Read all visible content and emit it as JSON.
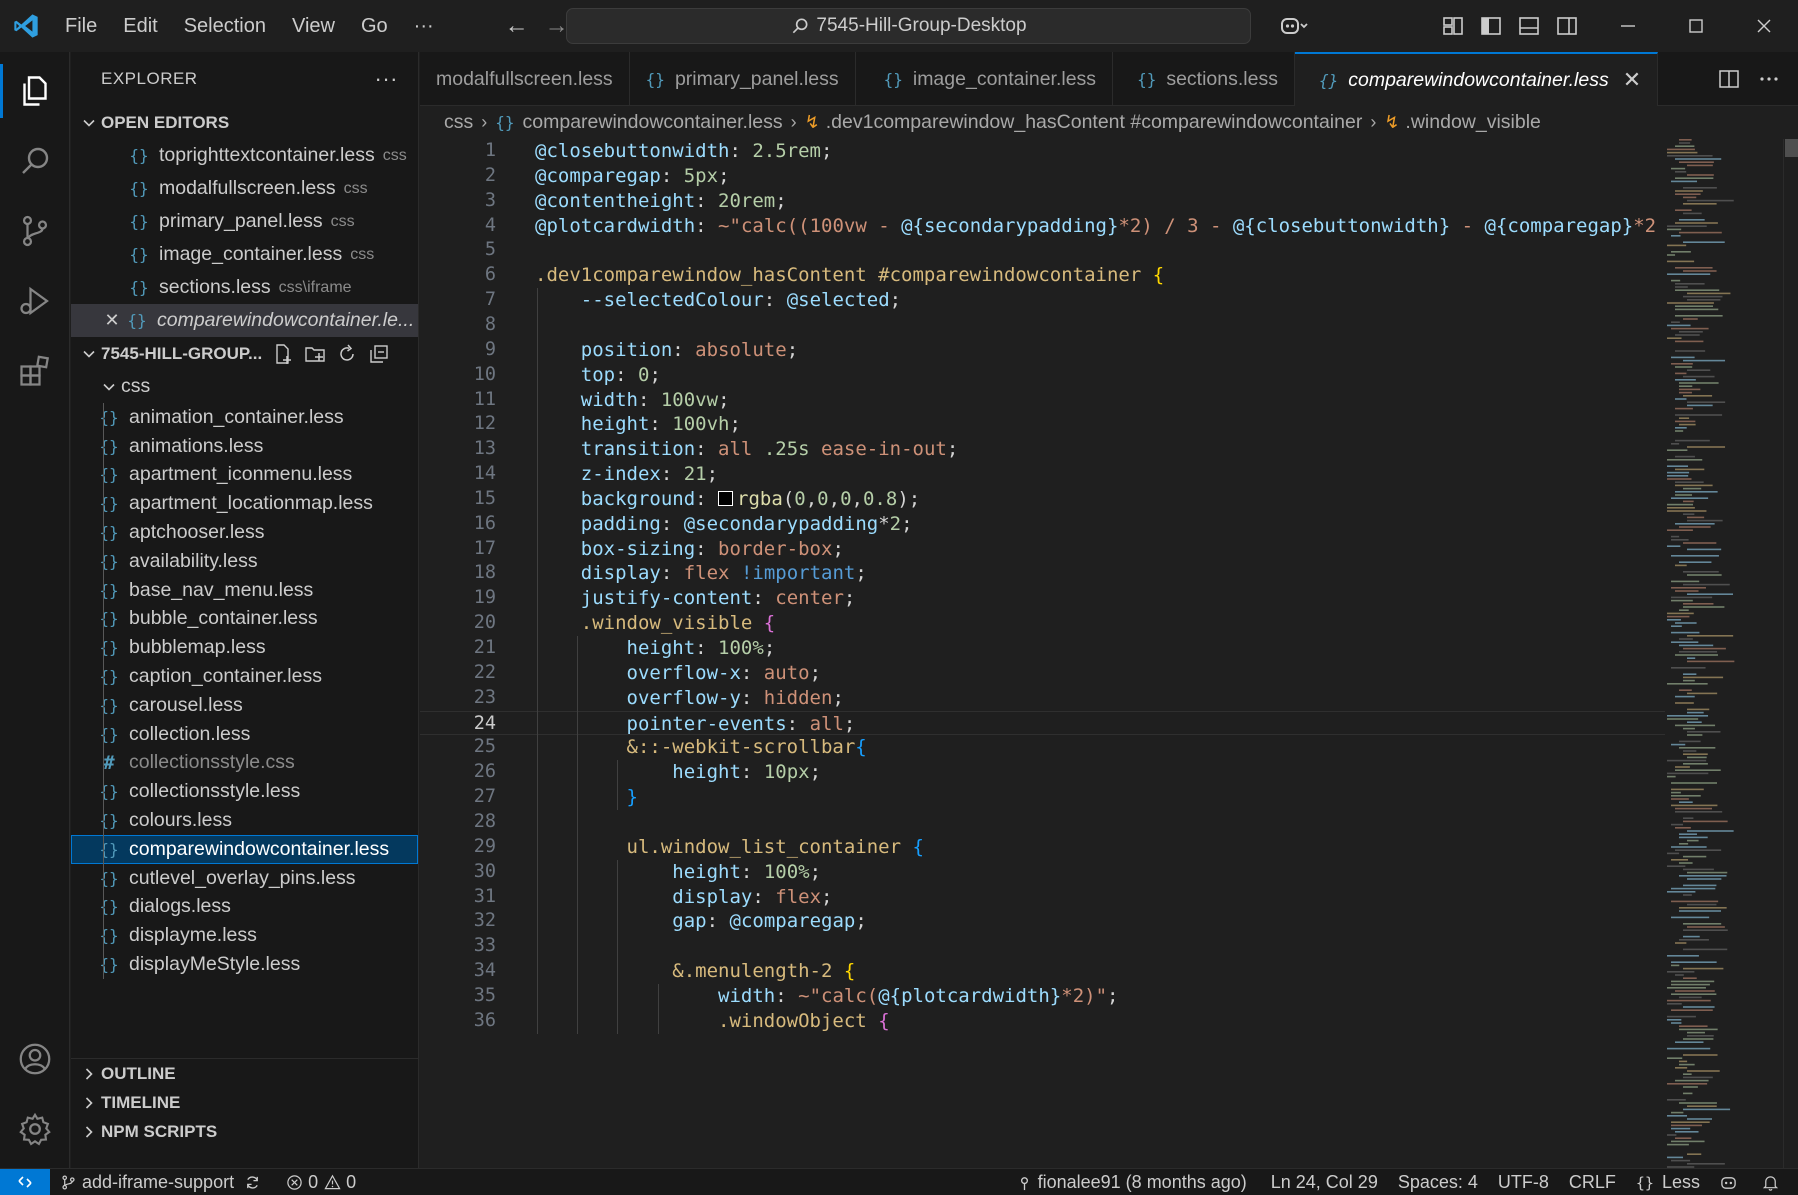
{
  "titlebar": {
    "menu": [
      "File",
      "Edit",
      "Selection",
      "View",
      "Go"
    ],
    "more": "···",
    "search_text": "7545-Hill-Group-Desktop"
  },
  "sidebar": {
    "title": "EXPLORER",
    "more": "···",
    "open_editors": {
      "heading": "OPEN EDITORS",
      "items": [
        {
          "name": "toprighttextcontainer.less",
          "folder": "css"
        },
        {
          "name": "modalfullscreen.less",
          "folder": "css"
        },
        {
          "name": "primary_panel.less",
          "folder": "css"
        },
        {
          "name": "image_container.less",
          "folder": "css"
        },
        {
          "name": "sections.less",
          "folder": "css\\iframe"
        },
        {
          "name": "comparewindowcontainer.le...",
          "folder": ""
        }
      ]
    },
    "project": {
      "heading": "7545-HILL-GROUP...",
      "folder": "css",
      "files": [
        "animation_container.less",
        "animations.less",
        "apartment_iconmenu.less",
        "apartment_locationmap.less",
        "aptchooser.less",
        "availability.less",
        "base_nav_menu.less",
        "bubble_container.less",
        "bubblemap.less",
        "caption_container.less",
        "carousel.less",
        "collection.less",
        "collectionsstyle.css",
        "collectionsstyle.less",
        "colours.less",
        "comparewindowcontainer.less",
        "cutlevel_overlay_pins.less",
        "dialogs.less",
        "displayme.less",
        "displayMeStyle.less"
      ]
    },
    "bottom_sections": [
      "OUTLINE",
      "TIMELINE",
      "NPM SCRIPTS"
    ]
  },
  "tabs": [
    {
      "label": "modalfullscreen.less"
    },
    {
      "label": "primary_panel.less"
    },
    {
      "label": "image_container.less"
    },
    {
      "label": "sections.less"
    },
    {
      "label": "comparewindowcontainer.less"
    }
  ],
  "breadcrumb": {
    "folder": "css",
    "file": "comparewindowcontainer.less",
    "symbol1": ".dev1comparewindow_hasContent #comparewindowcontainer",
    "symbol2": ".window_visible"
  },
  "editor": {
    "lines": [
      "@closebuttonwidth: 2.5rem;",
      "@comparegap: 5px;",
      "@contentheight: 20rem;",
      "@plotcardwidth: ~\"calc((100vw - @{secondarypadding}*2) / 3 - @{closebuttonwidth} - @{comparegap}*2",
      "",
      ".dev1comparewindow_hasContent #comparewindowcontainer {",
      "    --selectedColour: @selected;",
      "",
      "    position: absolute;",
      "    top: 0;",
      "    width: 100vw;",
      "    height: 100vh;",
      "    transition: all .25s ease-in-out;",
      "    z-index: 21;",
      "    background: rgba(0,0,0,0.8);",
      "    padding: @secondarypadding*2;",
      "    box-sizing: border-box;",
      "    display: flex !important;",
      "    justify-content: center;",
      "    .window_visible {",
      "        height: 100%;",
      "        overflow-x: auto;",
      "        overflow-y: hidden;",
      "        pointer-events: all;",
      "        &::-webkit-scrollbar{",
      "            height: 10px;",
      "        }",
      "",
      "        ul.window_list_container {",
      "            height: 100%;",
      "            display: flex;",
      "            gap: @comparegap;",
      "",
      "            &.menulength-2 {",
      "                width: ~\"calc(@{plotcardwidth}*2)\";",
      "                .windowObject {"
    ],
    "current_line": 24
  },
  "statusbar": {
    "branch": "add-iframe-support",
    "errors": "0",
    "warnings": "0",
    "blame": "fionalee91 (8 months ago)",
    "position": "Ln 24, Col 29",
    "spaces": "Spaces: 4",
    "encoding": "UTF-8",
    "eol": "CRLF",
    "language": "Less"
  },
  "colors": {
    "accent": "#0078d4",
    "less_icon": "#519aba"
  }
}
